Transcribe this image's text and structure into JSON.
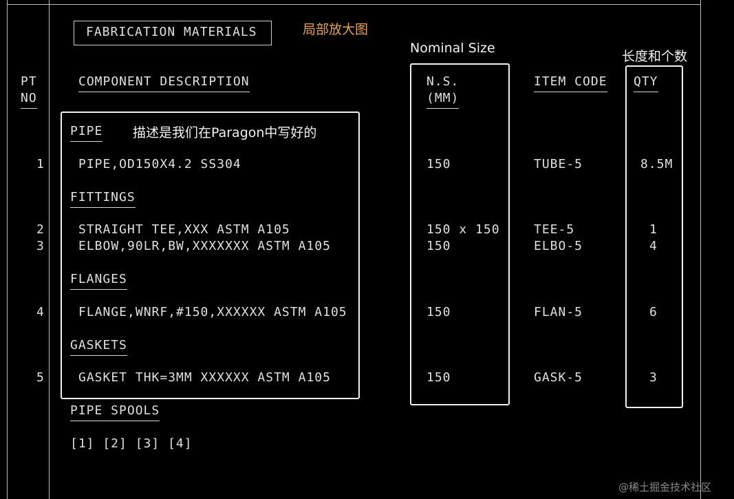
{
  "header": {
    "title": "FABRICATION MATERIALS",
    "annotation_zoom": "局部放大图"
  },
  "columns": {
    "pt_no": [
      "PT",
      "NO"
    ],
    "description": "COMPONENT DESCRIPTION",
    "ns": [
      "N.S.",
      "(MM)"
    ],
    "item_code": "ITEM CODE",
    "qty": "QTY"
  },
  "annotations": {
    "description_note": "描述是我们在Paragon中写好的",
    "nominal_size": "Nominal Size",
    "length_qty": "长度和个数"
  },
  "sections": [
    {
      "name": "PIPE",
      "rows": [
        {
          "pt": "1",
          "desc": "PIPE,OD150X4.2 SS304",
          "ns": "150",
          "code": "TUBE-5",
          "qty": "8.5M"
        }
      ]
    },
    {
      "name": "FITTINGS",
      "rows": [
        {
          "pt": "2",
          "desc": "STRAIGHT TEE,XXX ASTM A105",
          "ns": "150 x 150",
          "code": "TEE-5",
          "qty": "1"
        },
        {
          "pt": "3",
          "desc": "ELBOW,90LR,BW,XXXXXXX ASTM A105",
          "ns": "150",
          "code": "ELBO-5",
          "qty": "4"
        }
      ]
    },
    {
      "name": "FLANGES",
      "rows": [
        {
          "pt": "4",
          "desc": "FLANGE,WNRF,#150,XXXXXX ASTM A105",
          "ns": "150",
          "code": "FLAN-5",
          "qty": "6"
        }
      ]
    },
    {
      "name": "GASKETS",
      "rows": [
        {
          "pt": "5",
          "desc": "GASKET THK=3MM XXXXXX ASTM A105",
          "ns": "150",
          "code": "GASK-5",
          "qty": "3"
        }
      ]
    }
  ],
  "spools": {
    "title": "PIPE SPOOLS",
    "items": "[1] [2] [3] [4]"
  },
  "watermark": "@稀土掘金技术社区"
}
